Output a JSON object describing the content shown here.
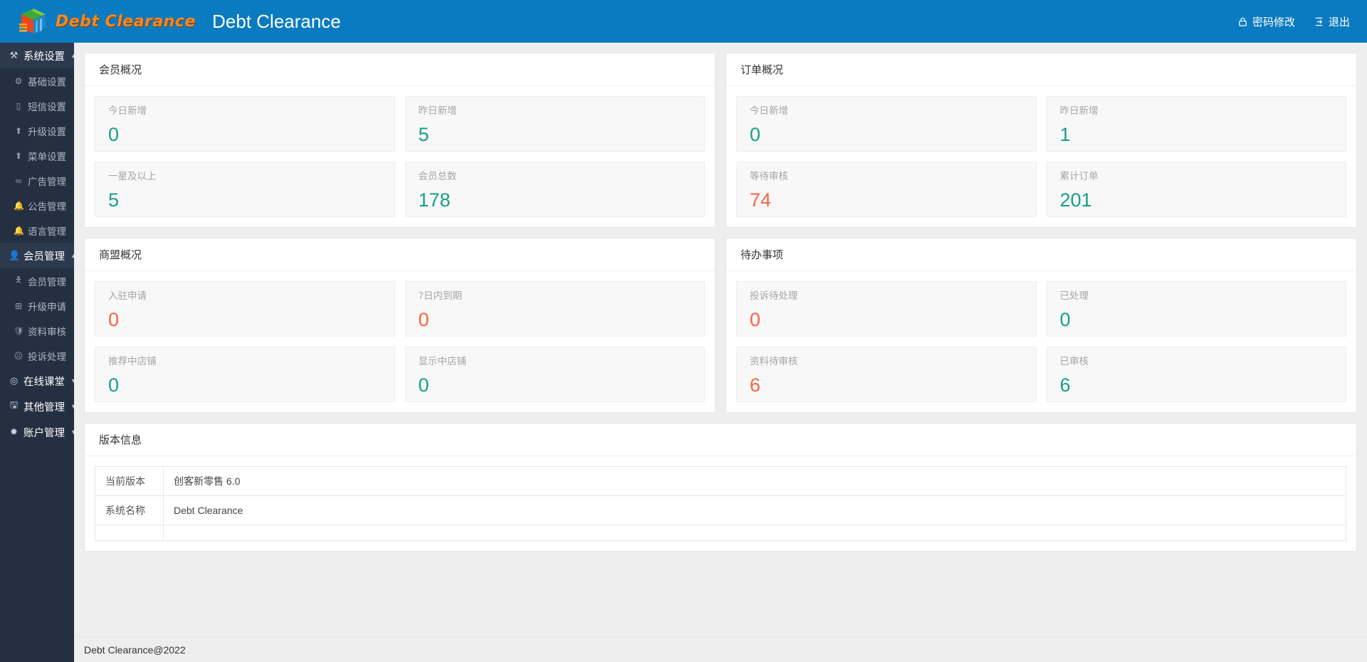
{
  "header": {
    "brand_word": "Debt Clearance",
    "app_title": "Debt Clearance",
    "logo_icon": "cube-logo-icon",
    "links": [
      {
        "label": "密码修改",
        "icon": "lock-icon"
      },
      {
        "label": "退出",
        "icon": "logout-icon"
      }
    ]
  },
  "sidebar": {
    "groups": [
      {
        "label": "系统设置",
        "icon": "sliders-icon",
        "expanded": true,
        "caret": "▲",
        "active": true,
        "items": [
          {
            "label": "基础设置",
            "icon": "gear-icon"
          },
          {
            "label": "短信设置",
            "icon": "mobile-icon"
          },
          {
            "label": "升级设置",
            "icon": "up-circle-icon"
          },
          {
            "label": "菜单设置",
            "icon": "up-circle-icon"
          },
          {
            "label": "广告管理",
            "icon": "link-icon"
          },
          {
            "label": "公告管理",
            "icon": "bell-icon"
          },
          {
            "label": "语言管理",
            "icon": "bell-icon"
          }
        ]
      },
      {
        "label": "会员管理",
        "icon": "user-badge-icon",
        "expanded": true,
        "caret": "▲",
        "active": true,
        "items": [
          {
            "label": "会员管理",
            "icon": "user-icon"
          },
          {
            "label": "升级申请",
            "icon": "grid-icon"
          },
          {
            "label": "资料审核",
            "icon": "shield-check-icon"
          },
          {
            "label": "投诉处理",
            "icon": "frown-icon"
          }
        ]
      },
      {
        "label": "在线课堂",
        "icon": "compass-icon",
        "expanded": false,
        "caret": "▼",
        "active": false,
        "items": []
      },
      {
        "label": "其他管理",
        "icon": "save-icon",
        "expanded": false,
        "caret": "▼",
        "active": false,
        "items": []
      },
      {
        "label": "账户管理",
        "icon": "gear-solid-icon",
        "expanded": false,
        "caret": "▼",
        "active": false,
        "items": []
      }
    ]
  },
  "panels": {
    "member": {
      "title": "会员概况",
      "stats": [
        [
          {
            "label": "今日新增",
            "value": "0",
            "color": "teal"
          },
          {
            "label": "昨日新增",
            "value": "5",
            "color": "teal"
          }
        ],
        [
          {
            "label": "一星及以上",
            "value": "5",
            "color": "teal"
          },
          {
            "label": "会员总数",
            "value": "178",
            "color": "teal"
          }
        ]
      ]
    },
    "order": {
      "title": "订单概况",
      "stats": [
        [
          {
            "label": "今日新增",
            "value": "0",
            "color": "teal"
          },
          {
            "label": "昨日新增",
            "value": "1",
            "color": "teal"
          }
        ],
        [
          {
            "label": "等待审核",
            "value": "74",
            "color": "orange"
          },
          {
            "label": "累计订单",
            "value": "201",
            "color": "teal"
          }
        ]
      ]
    },
    "alliance": {
      "title": "商盟概况",
      "stats": [
        [
          {
            "label": "入驻申请",
            "value": "0",
            "color": "orange"
          },
          {
            "label": "7日内到期",
            "value": "0",
            "color": "orange"
          }
        ],
        [
          {
            "label": "推荐中店铺",
            "value": "0",
            "color": "teal"
          },
          {
            "label": "显示中店铺",
            "value": "0",
            "color": "teal"
          }
        ]
      ]
    },
    "todo": {
      "title": "待办事项",
      "stats": [
        [
          {
            "label": "投诉待处理",
            "value": "0",
            "color": "orange"
          },
          {
            "label": "已处理",
            "value": "0",
            "color": "teal"
          }
        ],
        [
          {
            "label": "资料待审核",
            "value": "6",
            "color": "orange"
          },
          {
            "label": "已审核",
            "value": "6",
            "color": "teal"
          }
        ]
      ]
    },
    "version": {
      "title": "版本信息",
      "rows": [
        {
          "key": "当前版本",
          "value": "创客新零售 6.0"
        },
        {
          "key": "系统名称",
          "value": "Debt Clearance"
        }
      ]
    }
  },
  "footer": {
    "text": "Debt Clearance@2022"
  },
  "colors": {
    "header_blue": "#0b7bc1",
    "sidebar_dark": "#242f42",
    "sidebar_active": "#2d394d",
    "teal": "#16a085",
    "orange": "#fb6340",
    "brand_orange": "#f6871f"
  }
}
